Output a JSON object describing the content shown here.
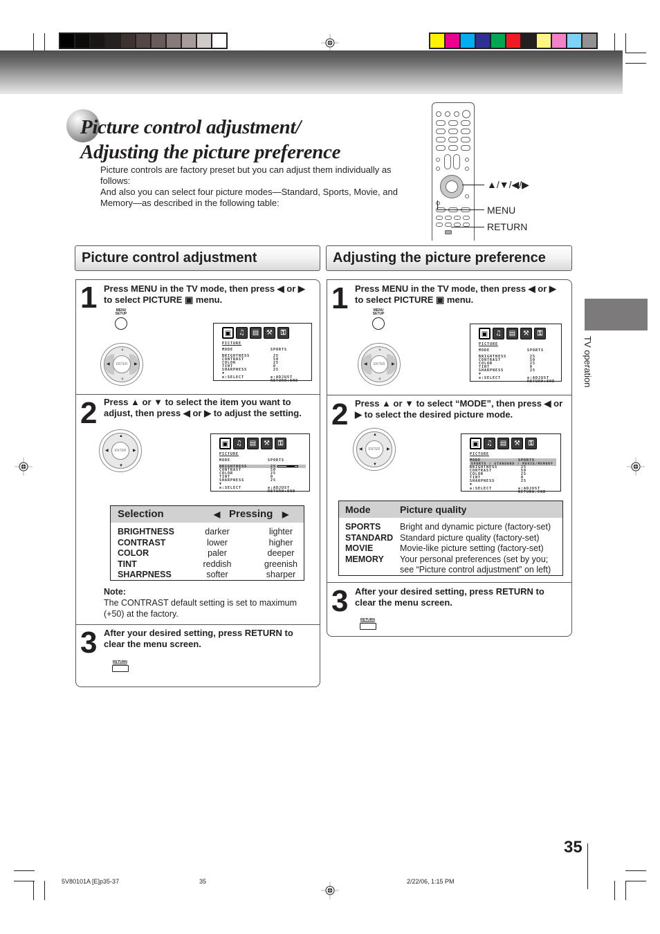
{
  "print_marks": {
    "gray_swatches": [
      "#000000",
      "#0d0b0a",
      "#1a1615",
      "#252120",
      "#3c3230",
      "#524744",
      "#675c59",
      "#867b78",
      "#a69c99",
      "#cfc9c7",
      "#ffffff"
    ],
    "color_swatches": [
      "#fff200",
      "#ec008c",
      "#00aeef",
      "#2e3192",
      "#00a651",
      "#ed1c24",
      "#231f20",
      "#fff685",
      "#f282c7",
      "#7dd3f7",
      "#939191"
    ]
  },
  "title": {
    "line1": "Picture control adjustment/",
    "line2": "Adjusting the picture preference"
  },
  "intro": {
    "para1": "Picture controls are factory preset but you can adjust them individually as follows:",
    "para2": "And also you can select four picture modes—Standard, Sports, Movie, and Memory—as described in the following table:"
  },
  "remote": {
    "arrows_label": "▲/▼/◀/▶",
    "menu_label": "MENU",
    "return_label": "RETURN"
  },
  "left_section": {
    "header": "Picture control adjustment",
    "steps": [
      {
        "num": "1",
        "text": "Press MENU in the TV mode, then press ◀ or ▶ to select PICTURE ▣ menu."
      },
      {
        "num": "2",
        "text": "Press ▲ or ▼ to select the item you want to adjust, then press ◀ or ▶ to adjust the setting."
      },
      {
        "num": "3",
        "text": "After your desired setting, press RETURN to clear the menu screen."
      }
    ],
    "selection_table": {
      "col_selection": "Selection",
      "col_pressing": "Pressing",
      "left_arrow": "◀",
      "right_arrow": "▶",
      "rows": [
        {
          "item": "BRIGHTNESS",
          "left": "darker",
          "right": "lighter"
        },
        {
          "item": "CONTRAST",
          "left": "lower",
          "right": "higher"
        },
        {
          "item": "COLOR",
          "left": "paler",
          "right": "deeper"
        },
        {
          "item": "TINT",
          "left": "reddish",
          "right": "greenish"
        },
        {
          "item": "SHARPNESS",
          "left": "softer",
          "right": "sharper"
        }
      ]
    },
    "note_title": "Note:",
    "note_text": "The CONTRAST default setting is set to maximum (+50) at the factory."
  },
  "right_section": {
    "header": "Adjusting the picture preference",
    "steps": [
      {
        "num": "1",
        "text": "Press MENU in the TV mode, then press ◀ or ▶ to select PICTURE ▣ menu."
      },
      {
        "num": "2",
        "text": "Press ▲ or ▼ to select “MODE”, then press ◀ or ▶ to select the desired picture mode."
      },
      {
        "num": "3",
        "text": "After your desired setting, press RETURN to clear the menu screen."
      }
    ],
    "mode_table": {
      "col_mode": "Mode",
      "col_quality": "Picture quality",
      "rows": [
        {
          "mode": "SPORTS",
          "desc": "Bright and dynamic picture (factory-set)"
        },
        {
          "mode": "STANDARD",
          "desc": "Standard picture quality (factory-set)"
        },
        {
          "mode": "MOVIE",
          "desc": "Movie-like picture setting (factory-set)"
        },
        {
          "mode": "MEMORY",
          "desc": "Your personal preferences (set by you; see “Picture control adjustment” on left)"
        }
      ]
    }
  },
  "remote_buttons": {
    "menu_setup_line1": "MENU",
    "menu_setup_line2": "SETUP",
    "enter": "ENTER",
    "return": "RETURN"
  },
  "osd": {
    "title": "PICTURE",
    "mode_label": "MODE",
    "mode_value": "SPORTS",
    "mode_options": "SPORTS / STANDARD / MOVIE/MEMORY",
    "items": [
      {
        "label": "BRIGHTNESS",
        "value": "25"
      },
      {
        "label": "CONTRAST",
        "value": "50"
      },
      {
        "label": "COLOR",
        "value": "25"
      },
      {
        "label": "TINT",
        "value": "0"
      },
      {
        "label": "SHARPNESS",
        "value": "25"
      }
    ],
    "more": "▼",
    "select_hint": "⊕:SELECT",
    "adjust_hint": "⊕:ADJUST",
    "return_hint": "RETURN:END",
    "icons": [
      "picture-icon",
      "audio-icon",
      "setup-icon",
      "tools-icon",
      "lock-icon"
    ]
  },
  "side_tab": {
    "label": "TV operation"
  },
  "page_number": "35",
  "footer": {
    "doc_id": "5V80101A [E]p35-37",
    "page": "35",
    "date": "2/22/06, 1:15 PM"
  }
}
